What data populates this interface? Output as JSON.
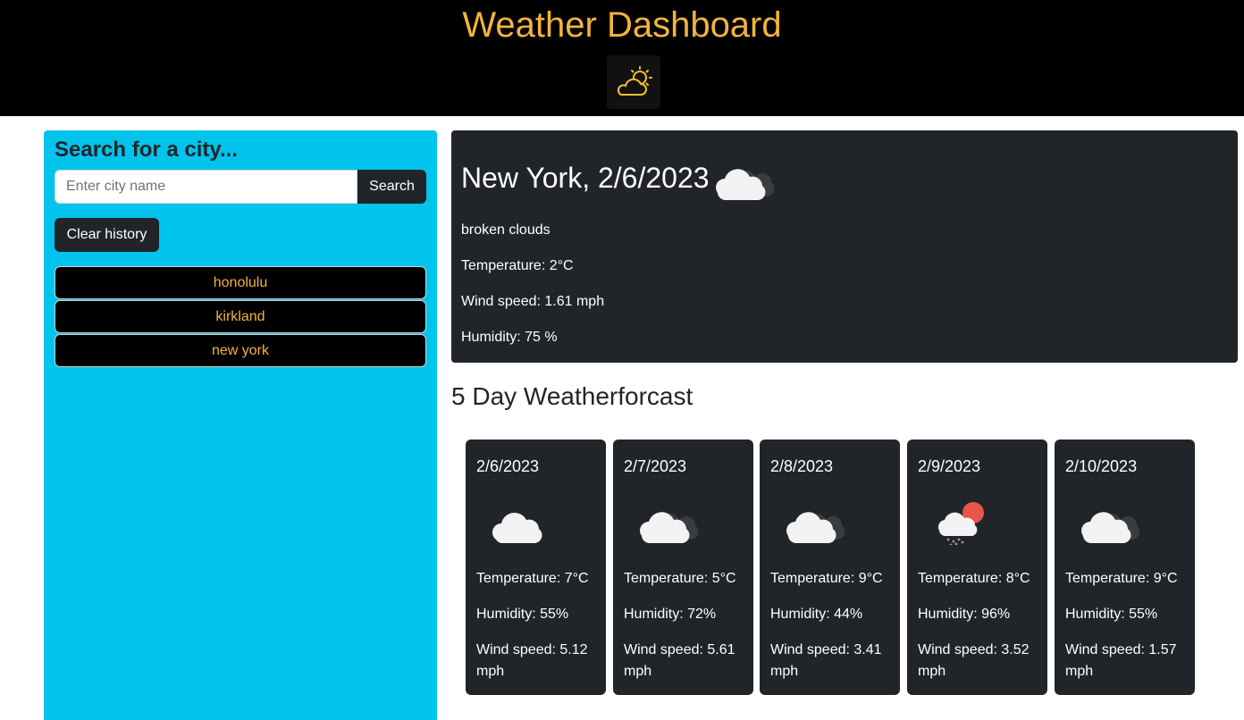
{
  "header": {
    "title": "Weather Dashboard",
    "title_color": "#f2b33d",
    "logo_icon": "cloud-sun-icon"
  },
  "sidebar": {
    "heading": "Search for a city...",
    "search_placeholder": "Enter city name",
    "search_value": "",
    "search_label": "Search",
    "clear_label": "Clear history",
    "background": "#00c4ec",
    "history": [
      "honolulu",
      "kirkland",
      "new york"
    ]
  },
  "current": {
    "heading": "New York, 2/6/2023",
    "icon": "broken-clouds-icon",
    "description": "broken clouds",
    "temperature": "Temperature: 2°C",
    "wind": "Wind speed: 1.61 mph",
    "humidity": "Humidity: 75 %"
  },
  "forecast": {
    "title": "5 Day Weatherforcast",
    "days": [
      {
        "date": "2/6/2023",
        "icon": "overcast-clouds-icon",
        "temperature": "Temperature: 7°C",
        "humidity": "Humidity: 55%",
        "wind": "Wind speed: 5.12 mph"
      },
      {
        "date": "2/7/2023",
        "icon": "broken-clouds-icon",
        "temperature": "Temperature: 5°C",
        "humidity": "Humidity: 72%",
        "wind": "Wind speed: 5.61 mph"
      },
      {
        "date": "2/8/2023",
        "icon": "broken-clouds-icon",
        "temperature": "Temperature: 9°C",
        "humidity": "Humidity: 44%",
        "wind": "Wind speed: 3.41 mph"
      },
      {
        "date": "2/9/2023",
        "icon": "rain-sun-icon",
        "temperature": "Temperature: 8°C",
        "humidity": "Humidity: 96%",
        "wind": "Wind speed: 3.52 mph"
      },
      {
        "date": "2/10/2023",
        "icon": "broken-clouds-icon",
        "temperature": "Temperature: 9°C",
        "humidity": "Humidity: 55%",
        "wind": "Wind speed: 1.57 mph"
      }
    ]
  }
}
